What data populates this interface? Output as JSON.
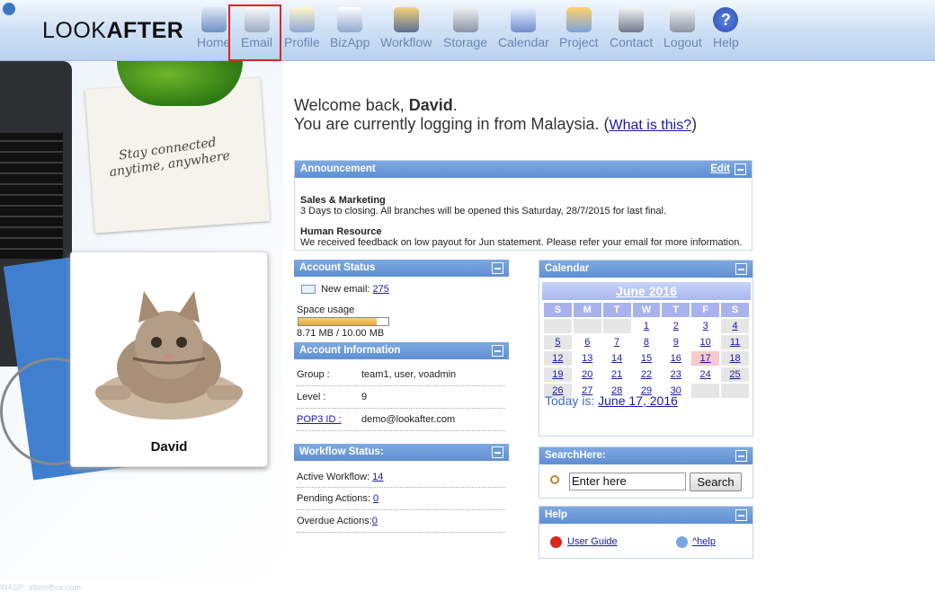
{
  "header": {
    "logo_light": "LOOK",
    "logo_bold": "AFTER",
    "nav": [
      {
        "label": "Home",
        "icon": "home-icon"
      },
      {
        "label": "Email",
        "icon": "email-icon"
      },
      {
        "label": "Profile",
        "icon": "profile-icon"
      },
      {
        "label": "BizApp",
        "icon": "bizapp-icon"
      },
      {
        "label": "Workflow",
        "icon": "workflow-icon"
      },
      {
        "label": "Storage",
        "icon": "storage-icon"
      },
      {
        "label": "Calendar",
        "icon": "calendar-icon"
      },
      {
        "label": "Project",
        "icon": "project-icon"
      },
      {
        "label": "Contact",
        "icon": "contact-icon"
      },
      {
        "label": "Logout",
        "icon": "logout-icon"
      },
      {
        "label": "Help",
        "icon": "help-icon"
      }
    ]
  },
  "left": {
    "tagline_1": "Stay connected",
    "tagline_2": "anytime, anywhere",
    "user_name": "David",
    "footer": "WASP: afteroffice.com"
  },
  "welcome": {
    "line1_prefix": "Welcome back, ",
    "user": "David",
    "line1_suffix": ".",
    "line2": "You are currently logging in from Malaysia. (",
    "link": "What is this?",
    "line2_suffix": ")"
  },
  "announcement": {
    "title": "Announcement",
    "edit": "Edit",
    "items": [
      {
        "heading": "Sales & Marketing",
        "text": "3 Days to closing. All branches will be opened this Saturday, 28/7/2015 for last final."
      },
      {
        "heading": "Human Resource",
        "text": "We received feedback on low payout for Jun statement. Please refer your email for more information."
      }
    ]
  },
  "account_status": {
    "title": "Account Status",
    "new_email_label": "New email:",
    "new_email_count": "275",
    "space_label": "Space usage",
    "space_used": 0.871,
    "space_text": "8.71 MB / 10.00 MB"
  },
  "account_info": {
    "title": "Account Information",
    "rows": [
      {
        "label": "Group :",
        "value": "team1, user, voadmin"
      },
      {
        "label": "Level :",
        "value": "9"
      },
      {
        "label": "POP3 ID :",
        "value": "demo@lookafter.com"
      }
    ]
  },
  "workflow": {
    "title": "Workflow Status:",
    "rows": [
      {
        "label": "Active Workflow:",
        "value": "14"
      },
      {
        "label": "Pending Actions:",
        "value": "0"
      },
      {
        "label": "Overdue Actions:",
        "value": "0"
      }
    ]
  },
  "calendar": {
    "title": "Calendar",
    "month": "June 2016",
    "days": [
      "S",
      "M",
      "T",
      "W",
      "T",
      "F",
      "S"
    ],
    "weeks": [
      [
        "",
        "",
        "",
        "1",
        "2",
        "3",
        "4"
      ],
      [
        "5",
        "6",
        "7",
        "8",
        "9",
        "10",
        "11"
      ],
      [
        "12",
        "13",
        "14",
        "15",
        "16",
        "17",
        "18"
      ],
      [
        "19",
        "20",
        "21",
        "22",
        "23",
        "24",
        "25"
      ],
      [
        "26",
        "27",
        "28",
        "29",
        "30",
        "",
        ""
      ]
    ],
    "today_label": "Today is:",
    "today_date": "June 17, 2016"
  },
  "search": {
    "title": "SearchHere:",
    "value": "Enter here",
    "button": "Search"
  },
  "help": {
    "title": "Help",
    "guide": "User Guide",
    "ahelp": "^help"
  },
  "colors": {
    "accent": "#5f8fd3",
    "highlight": "#e0242b"
  }
}
